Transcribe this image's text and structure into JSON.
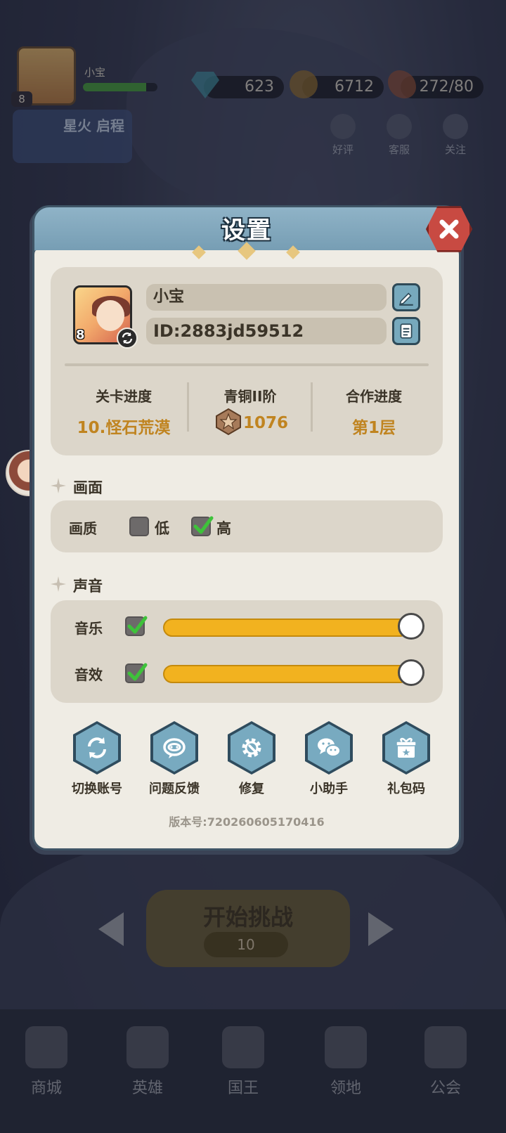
{
  "hud": {
    "player_name": "小宝",
    "level": "8",
    "gems": "623",
    "coins": "6712",
    "stamina": "272/80",
    "banner": "星火 启程",
    "side_buttons": [
      "好评",
      "客服",
      "关注"
    ]
  },
  "dialog": {
    "title": "设置",
    "profile": {
      "name": "小宝",
      "id": "ID:2883jd59512",
      "avatar_level": "8"
    },
    "stats": [
      {
        "label": "关卡进度",
        "value": "10.怪石荒漠"
      },
      {
        "label": "青铜II阶",
        "value": "1076"
      },
      {
        "label": "合作进度",
        "value": "第1层"
      }
    ],
    "graphics": {
      "section_title": "画面",
      "quality_label": "画质",
      "options": [
        {
          "label": "低",
          "checked": false
        },
        {
          "label": "高",
          "checked": true
        }
      ]
    },
    "sound": {
      "section_title": "声音",
      "music": {
        "label": "音乐",
        "enabled": true,
        "level": 1.0
      },
      "effects": {
        "label": "音效",
        "enabled": true,
        "level": 1.0
      }
    },
    "actions": [
      {
        "label": "切换账号",
        "icon": "switch-account-icon"
      },
      {
        "label": "问题反馈",
        "icon": "feedback-icon"
      },
      {
        "label": "修复",
        "icon": "repair-gear-icon"
      },
      {
        "label": "小助手",
        "icon": "wechat-icon"
      },
      {
        "label": "礼包码",
        "icon": "gift-icon"
      }
    ],
    "version": "版本号:720260605170416"
  },
  "stage": {
    "start_label": "开始挑战",
    "cost": "10"
  },
  "nav": [
    "商城",
    "英雄",
    "国王",
    "领地",
    "公会"
  ],
  "colors": {
    "accent_gold": "#c08420",
    "slider": "#f2b21f",
    "close": "#c84a42",
    "button_blue": "#78aac0",
    "check_green": "#3ec23a"
  }
}
